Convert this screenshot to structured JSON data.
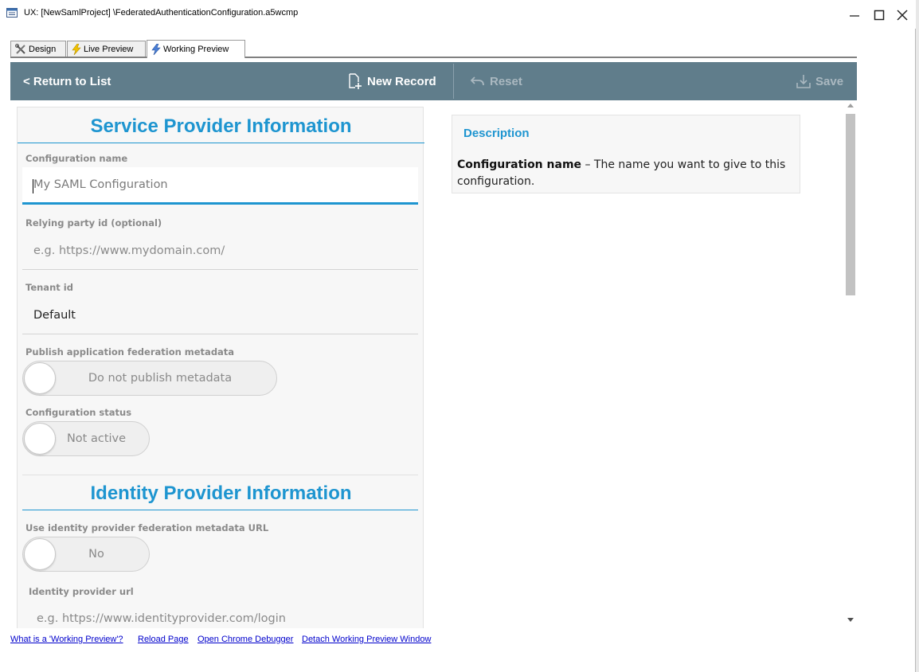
{
  "window": {
    "title": "UX: [NewSamlProject] \\FederatedAuthenticationConfiguration.a5wcmp"
  },
  "tabs": [
    {
      "label": "Design",
      "icon": "tools-icon"
    },
    {
      "label": "Live Preview",
      "icon": "lightning-icon"
    },
    {
      "label": "Working Preview",
      "icon": "lightning-icon",
      "active": true
    }
  ],
  "toolbar": {
    "back_label": "< Return to List",
    "new_label": "New Record",
    "reset_label": "Reset",
    "save_label": "Save"
  },
  "service_provider": {
    "title": "Service Provider Information",
    "config_name": {
      "label": "Configuration name",
      "placeholder": "My SAML Configuration",
      "value": ""
    },
    "relying_party": {
      "label": "Relying party id (optional)",
      "placeholder": "e.g. https://www.mydomain.com/",
      "value": ""
    },
    "tenant": {
      "label": "Tenant id",
      "value": "Default"
    },
    "publish_metadata": {
      "label": "Publish application federation metadata",
      "state": "Do not publish metadata",
      "on": false
    },
    "config_status": {
      "label": "Configuration status",
      "state": "Not active",
      "on": false
    }
  },
  "identity_provider": {
    "title": "Identity Provider Information",
    "use_metadata_url": {
      "label": "Use identity provider federation metadata URL",
      "state": "No",
      "on": false
    },
    "idp_url": {
      "label": "Identity provider url",
      "placeholder": "e.g. https://www.identityprovider.com/login",
      "value": ""
    }
  },
  "description": {
    "title": "Description",
    "term": "Configuration name",
    "text": " – The name you want to give to this configuration."
  },
  "footer": {
    "link1": "What is a 'Working Preview'?",
    "link2": "Reload Page",
    "link3": "Open Chrome Debugger",
    "link4": "Detach Working Preview Window"
  },
  "colors": {
    "toolbar_bg": "#607d8b",
    "accent": "#1e95d0",
    "disabled_text": "#aab8c0"
  }
}
